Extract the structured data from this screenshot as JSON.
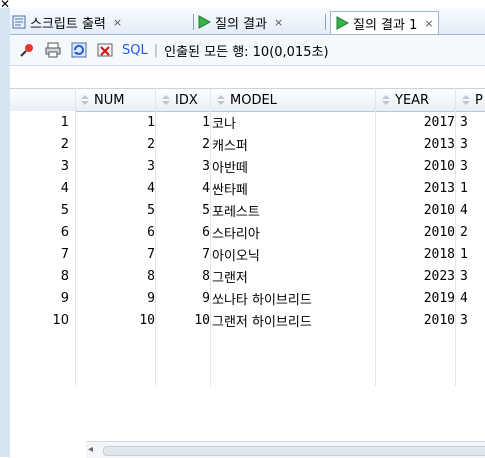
{
  "window": {
    "top_close_icon": "✕"
  },
  "tabs": [
    {
      "label": "스크립트 출력",
      "close": "×"
    },
    {
      "label": "질의 결과",
      "close": "×"
    },
    {
      "label": "질의 결과 1",
      "close": "×"
    }
  ],
  "toolbar": {
    "sql_label": "SQL",
    "separator": "|",
    "status": "인출된 모든 행: 10(0,015초)"
  },
  "grid": {
    "columns": [
      "NUM",
      "IDX",
      "MODEL",
      "YEAR",
      "P"
    ],
    "rows": [
      {
        "row": "1",
        "num": "1",
        "idx": "1",
        "model": "코나",
        "year": "2017",
        "p": "3"
      },
      {
        "row": "2",
        "num": "2",
        "idx": "2",
        "model": "캐스퍼",
        "year": "2013",
        "p": "3"
      },
      {
        "row": "3",
        "num": "3",
        "idx": "3",
        "model": "아반떼",
        "year": "2010",
        "p": "3"
      },
      {
        "row": "4",
        "num": "4",
        "idx": "4",
        "model": "싼타페",
        "year": "2013",
        "p": "1"
      },
      {
        "row": "5",
        "num": "5",
        "idx": "5",
        "model": "포레스트",
        "year": "2010",
        "p": "4"
      },
      {
        "row": "6",
        "num": "6",
        "idx": "6",
        "model": "스타리아",
        "year": "2010",
        "p": "2"
      },
      {
        "row": "7",
        "num": "7",
        "idx": "7",
        "model": "아이오닉",
        "year": "2018",
        "p": "1"
      },
      {
        "row": "8",
        "num": "8",
        "idx": "8",
        "model": "그랜저",
        "year": "2023",
        "p": "3"
      },
      {
        "row": "9",
        "num": "9",
        "idx": "9",
        "model": "쏘나타 하이브리드",
        "year": "2019",
        "p": "4"
      },
      {
        "row": "10",
        "num": "10",
        "idx": "10",
        "model": "그랜저 하이브리드",
        "year": "2010",
        "p": "3"
      }
    ]
  },
  "scrollbar": {
    "left_arrow": "◂"
  }
}
